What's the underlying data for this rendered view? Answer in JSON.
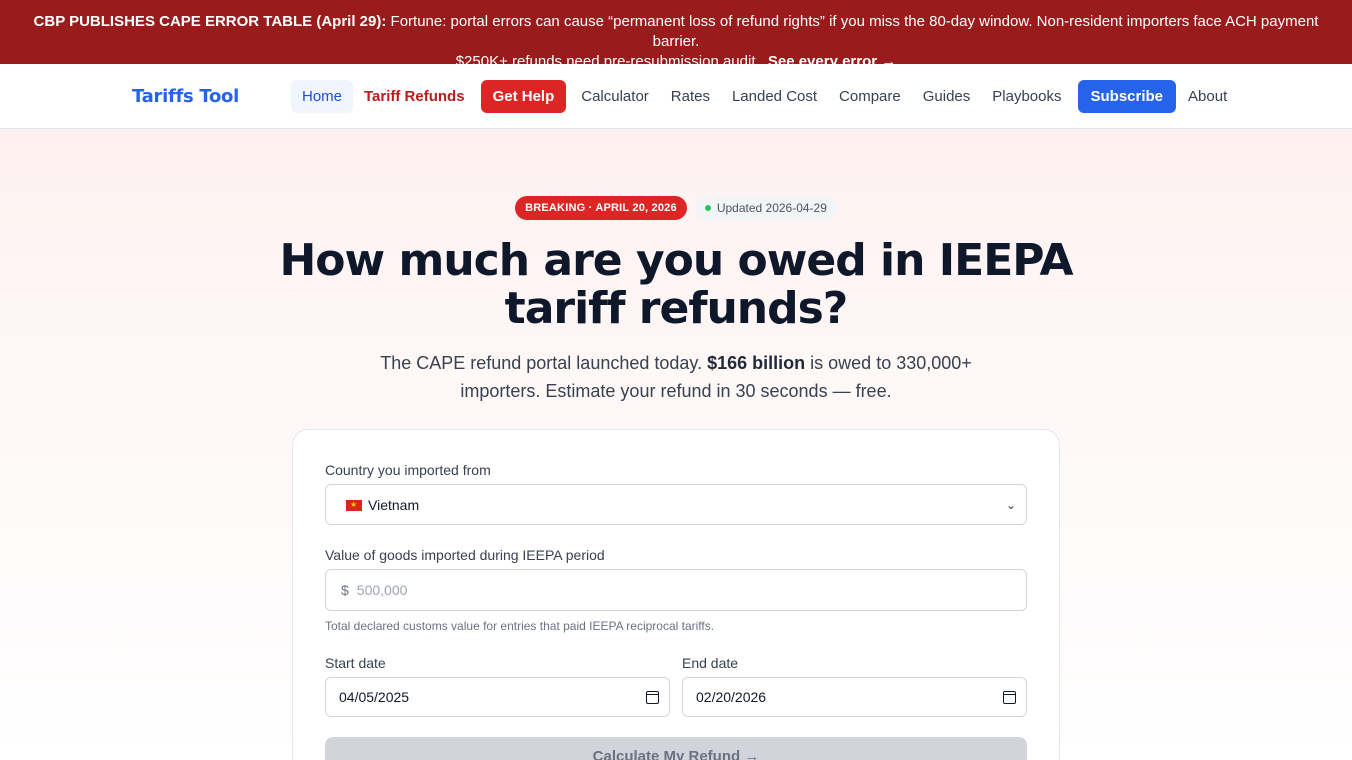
{
  "alert": {
    "lead": "CBP PUBLISHES CAPE ERROR TABLE (April 29):",
    "line1": "Fortune: portal errors can cause “permanent loss of refund rights” if you miss the 80-day window. Non-resident importers face ACH payment barrier.",
    "line2": "$250K+ refunds need pre-resubmission audit.",
    "link": "See every error →"
  },
  "nav": {
    "brand": "Tariffs Tool",
    "home": "Home",
    "refunds": "Tariff Refunds",
    "get_help": "Get Help",
    "calculator": "Calculator",
    "rates": "Rates",
    "landed_cost": "Landed Cost",
    "compare": "Compare",
    "guides": "Guides",
    "playbooks": "Playbooks",
    "subscribe": "Subscribe",
    "about": "About"
  },
  "hero": {
    "badge_breaking": "BREAKING · APRIL 20, 2026",
    "badge_updated": "Updated 2026-04-29",
    "headline_1": "How much are you owed in IEEPA",
    "headline_2": "tariff refunds?",
    "sub_a": "The CAPE refund portal launched today.",
    "sub_bold": "$166 billion",
    "sub_b": "is owed to 330,000+",
    "sub_line2": "importers. Estimate your refund in 30 seconds — free."
  },
  "form": {
    "country_label": "Country you imported from",
    "country_value": "Vietnam",
    "value_label": "Value of goods imported during IEEPA period",
    "currency_prefix": "$",
    "value_placeholder": "500,000",
    "value_hint": "Total declared customs value for entries that paid IEEPA reciprocal tariffs.",
    "start_label": "Start date",
    "start_value": "04/05/2025",
    "end_label": "End date",
    "end_value": "02/20/2026",
    "submit": "Calculate My Refund →"
  }
}
